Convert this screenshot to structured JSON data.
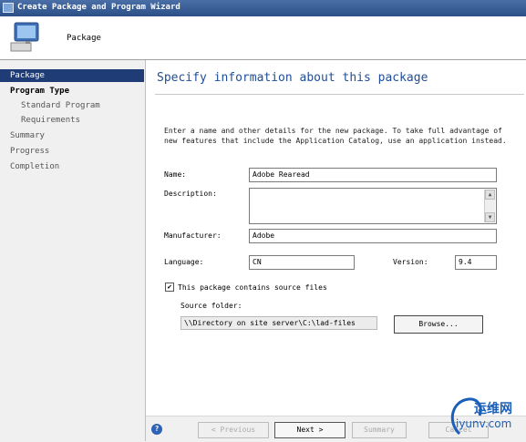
{
  "window": {
    "title": "Create Package and Program Wizard"
  },
  "header": {
    "label": "Package"
  },
  "sidebar": {
    "items": [
      {
        "label": "Package"
      },
      {
        "label": "Program Type"
      },
      {
        "label": "Standard Program"
      },
      {
        "label": "Requirements"
      },
      {
        "label": "Summary"
      },
      {
        "label": "Progress"
      },
      {
        "label": "Completion"
      }
    ]
  },
  "main": {
    "heading": "Specify information about this package",
    "intro": "Enter a name and other details for the new package. To take full advantage of new features that include the Application Catalog, use an application instead.",
    "name_label": "Name:",
    "name_value": "Adobe Rearead",
    "description_label": "Description:",
    "description_value": "",
    "manufacturer_label": "Manufacturer:",
    "manufacturer_value": "Adobe",
    "language_label": "Language:",
    "language_value": "CN",
    "version_label": "Version:",
    "version_value": "9.4",
    "source_checkbox_label": "This package contains source files",
    "source_checked": true,
    "source_folder_label": "Source folder:",
    "source_folder_value": "\\\\Directory on site server\\C:\\lad-files",
    "browse_label": "Browse..."
  },
  "footer": {
    "previous_label": "< Previous",
    "next_label": "Next >",
    "summary_label": "Summary",
    "cancel_label": "Cancel"
  },
  "watermark": {
    "top": "运维网",
    "bottom": "iyunv.com"
  }
}
